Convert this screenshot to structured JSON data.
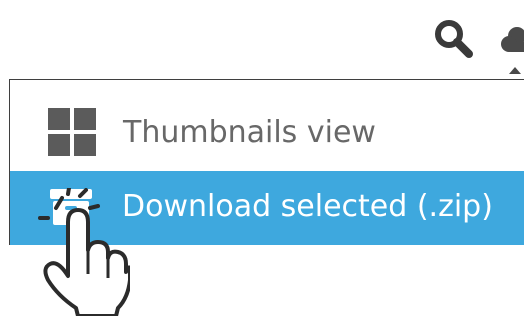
{
  "toolbar": {
    "icons": [
      "search-icon",
      "cloud-icon"
    ]
  },
  "menu": {
    "items": [
      {
        "label": "Thumbnails view",
        "icon": "grid-icon",
        "selected": false
      },
      {
        "label": "Download selected (.zip)",
        "icon": "archive-icon",
        "selected": true
      }
    ]
  },
  "colors": {
    "highlight": "#3ea8de",
    "menu_text": "#686868",
    "icon_gray": "#5b5b5b",
    "hand_stroke": "#2b2b2b"
  }
}
